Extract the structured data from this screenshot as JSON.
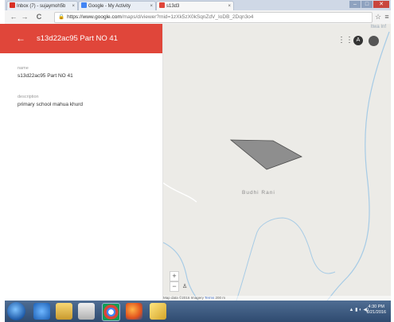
{
  "browser": {
    "tabs": [
      {
        "title": "Inbox (7) - sujaymoh5b",
        "favicon_color": "#d93025"
      },
      {
        "title": "Google - My Activity",
        "favicon_color": "#4285f4"
      },
      {
        "title": "s13d3",
        "favicon_color": "#e0463a"
      }
    ],
    "tab_close": "×",
    "window_controls": {
      "minimize": "–",
      "maximize": "□",
      "close": "✕"
    },
    "nav": {
      "back": "←",
      "forward": "→",
      "reload": "C"
    },
    "address": {
      "lock": "🔒",
      "url_prefix": "https://",
      "url_host": "www.google.com",
      "url_path": "/maps/d/viewer?mid=1zXk5zX0kSqnZdV_IoDB_2Dqn3o4"
    },
    "star": "☆",
    "menu": "≡"
  },
  "panel": {
    "back_icon": "←",
    "title": "s13d22ac95 Part NO 41",
    "fields": [
      {
        "label": "name",
        "value": "s13d22ac95 Part NO 41"
      },
      {
        "label": "description",
        "value": "primary school mahua khurd"
      }
    ],
    "header_color": "#e0463a"
  },
  "map": {
    "place_label": "Budhi Rani",
    "corner_label": "Itwa Inf",
    "apps_icon": "⋮⋮⋮",
    "user_initial": "A",
    "zoom_in": "+",
    "zoom_out": "−",
    "pegman": "♙",
    "attribution": {
      "data": "Map data ©2016 Imagery",
      "terms": "Terms",
      "scale": "200 m"
    },
    "polygon_color": "#8e8e8e",
    "water_color": "#a6cbe6"
  },
  "taskbar": {
    "tray_text": "▲ ▮ ◐ ◀)",
    "time": "4:30 PM",
    "date": "6/21/2016"
  }
}
